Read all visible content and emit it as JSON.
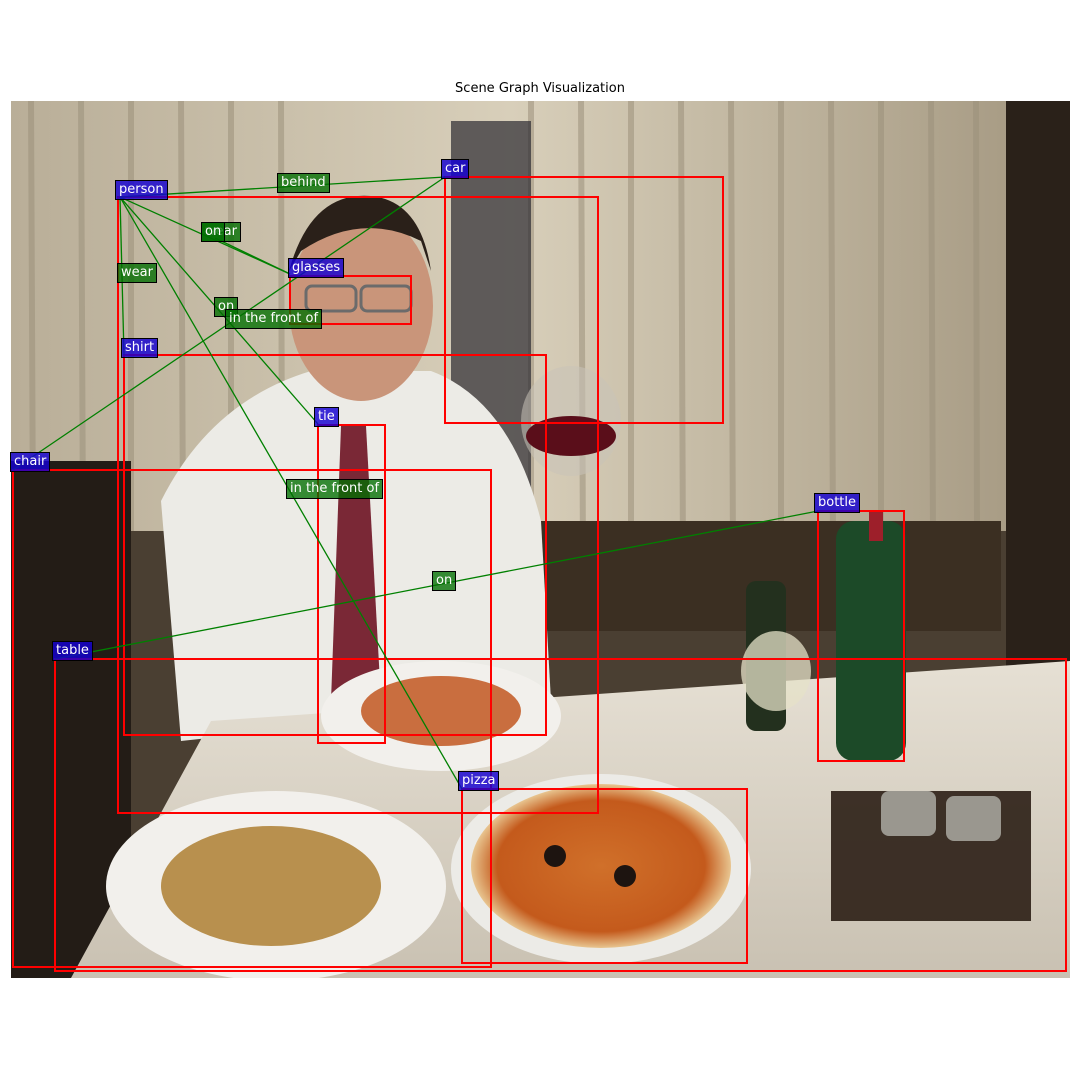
{
  "title": "Scene Graph Visualization",
  "colors": {
    "object_label": "#1f0fd2",
    "relation_label": "#0a7a0a",
    "bbox": "#ff0000",
    "edge": "#008000"
  },
  "objects": [
    {
      "id": "person",
      "label": "person"
    },
    {
      "id": "car",
      "label": "car"
    },
    {
      "id": "glasses",
      "label": "glasses"
    },
    {
      "id": "shirt",
      "label": "shirt"
    },
    {
      "id": "tie",
      "label": "tie"
    },
    {
      "id": "chair",
      "label": "chair"
    },
    {
      "id": "bottle",
      "label": "bottle"
    },
    {
      "id": "table",
      "label": "table"
    },
    {
      "id": "pizza",
      "label": "pizza"
    }
  ],
  "relations": [
    {
      "subject": "person",
      "predicate": "behind",
      "object": "car"
    },
    {
      "subject": "person",
      "predicate": "wear",
      "object": "glasses"
    },
    {
      "subject": "glasses",
      "predicate": "on",
      "object": "person"
    },
    {
      "subject": "person",
      "predicate": "wear",
      "object": "shirt"
    },
    {
      "subject": "person",
      "predicate": "on",
      "object": "tie"
    },
    {
      "subject": "car",
      "predicate": "in the front of",
      "object": "chair"
    },
    {
      "subject": "person",
      "predicate": "in the front of",
      "object": "pizza"
    },
    {
      "subject": "bottle",
      "predicate": "on",
      "object": "table"
    }
  ]
}
